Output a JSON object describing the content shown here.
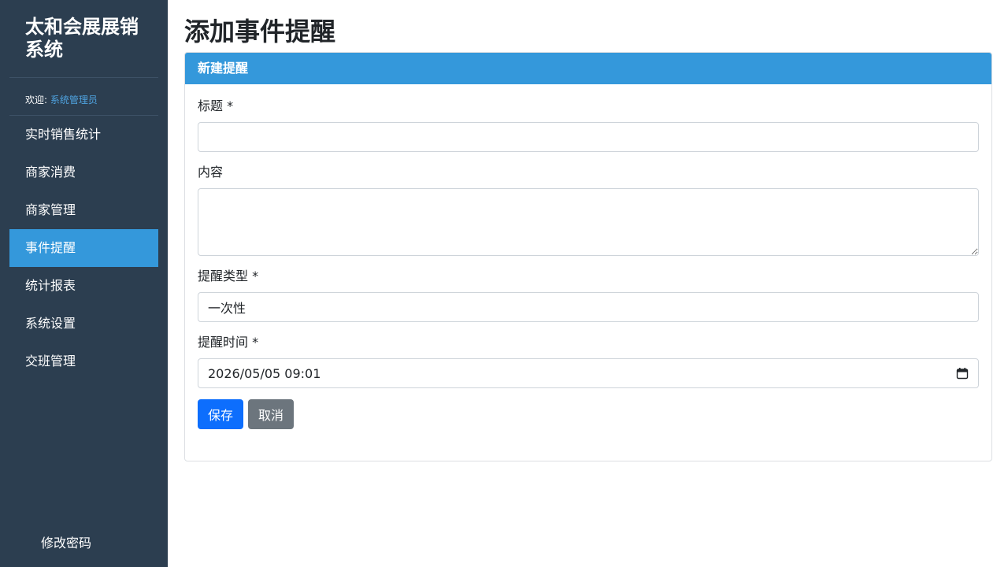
{
  "sidebar": {
    "brand": "太和会展展销系统",
    "welcome_label": "欢迎:",
    "welcome_user": "系统管理员",
    "items": [
      {
        "label": "实时销售统计"
      },
      {
        "label": "商家消费"
      },
      {
        "label": "商家管理"
      },
      {
        "label": "事件提醒"
      },
      {
        "label": "统计报表"
      },
      {
        "label": "系统设置"
      },
      {
        "label": "交班管理"
      }
    ],
    "active_index": 3,
    "footer": "修改密码"
  },
  "main": {
    "title": "添加事件提醒",
    "card_header": "新建提醒",
    "fields": {
      "title_label": "标题 *",
      "title_value": "",
      "content_label": "内容",
      "content_value": "",
      "type_label": "提醒类型 *",
      "type_value": "一次性",
      "time_label": "提醒时间 *",
      "time_value": "2026/05/05 09:01"
    },
    "save_label": "保存",
    "cancel_label": "取消"
  },
  "colors": {
    "sidebar_bg": "#2c3e50",
    "accent": "#3498db",
    "primary_button": "#0d6efd",
    "secondary_button": "#6c757d"
  },
  "icons": {
    "date_picker": "calendar-icon",
    "textarea_resize": "resize-grip-icon"
  }
}
